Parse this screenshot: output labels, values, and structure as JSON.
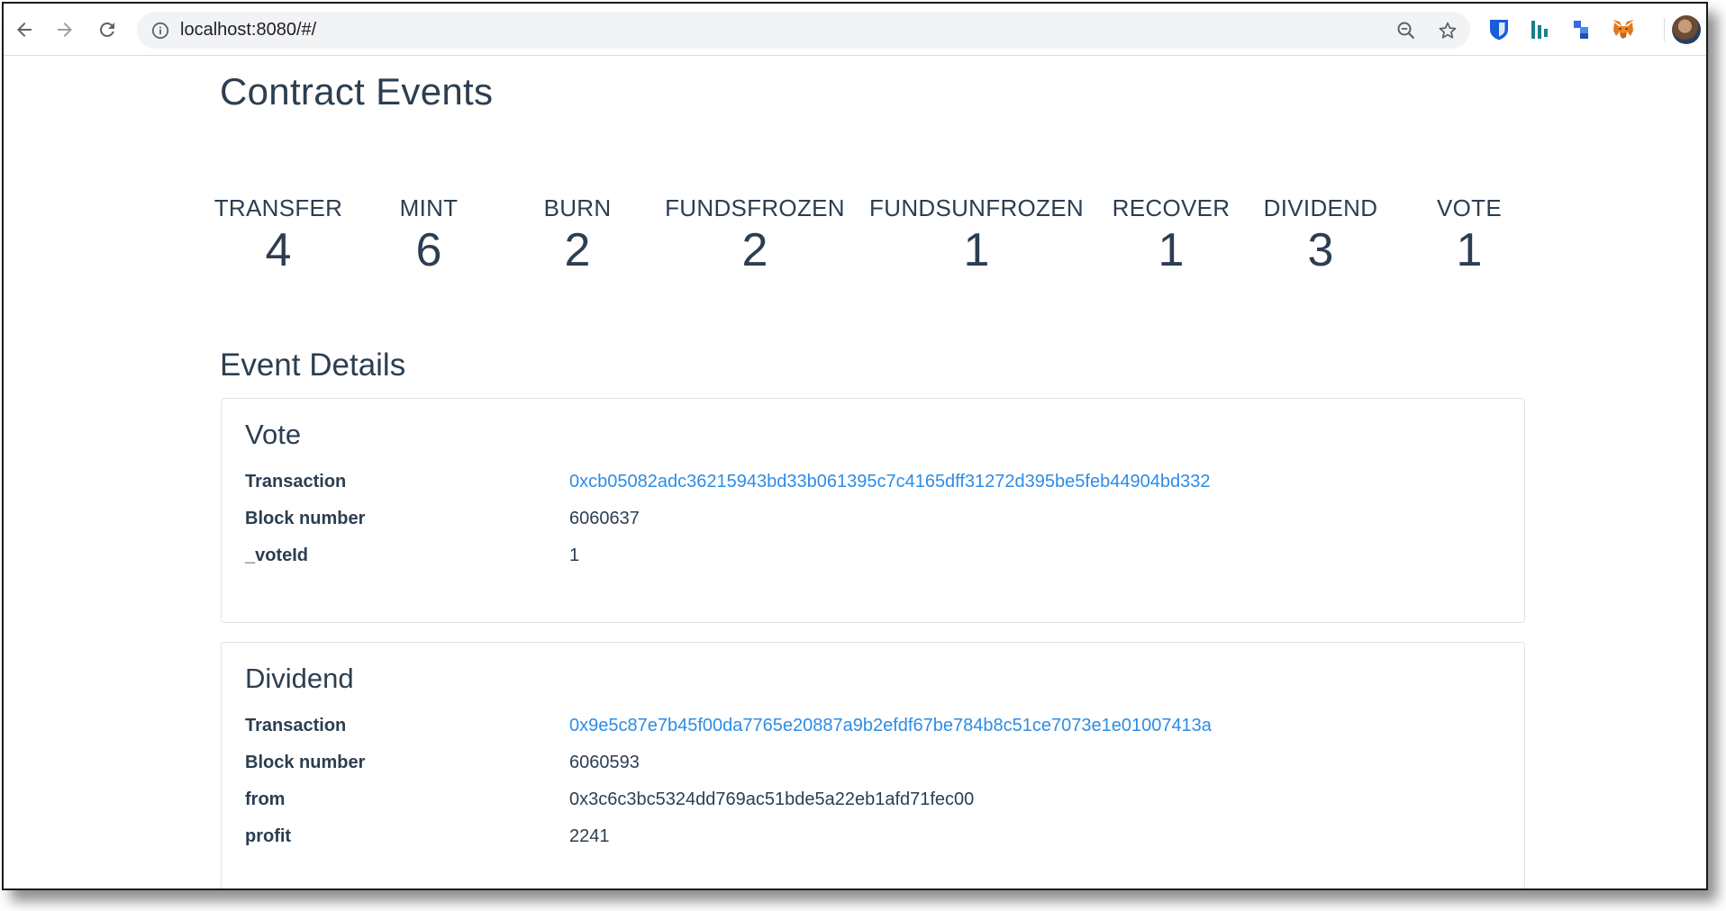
{
  "browser": {
    "url": "localhost:8080/#/",
    "icons": {
      "back": "arrow-left-icon",
      "forward": "arrow-right-icon",
      "reload": "reload-icon",
      "site_info": "info-circle-icon",
      "zoom": "zoom-out-icon",
      "bookmark": "star-icon",
      "extensions": [
        "bitwarden-icon",
        "chart-extension-icon",
        "blue-blocks-extension-icon",
        "metamask-fox-icon"
      ],
      "profile": "profile-avatar"
    }
  },
  "page": {
    "title": "Contract Events",
    "event_counts": [
      {
        "label": "TRANSFER",
        "count": "4"
      },
      {
        "label": "MINT",
        "count": "6"
      },
      {
        "label": "BURN",
        "count": "2"
      },
      {
        "label": "FUNDSFROZEN",
        "count": "2"
      },
      {
        "label": "FUNDSUNFROZEN",
        "count": "1"
      },
      {
        "label": "RECOVER",
        "count": "1"
      },
      {
        "label": "DIVIDEND",
        "count": "3"
      },
      {
        "label": "VOTE",
        "count": "1"
      }
    ],
    "details_title": "Event Details",
    "events": [
      {
        "name": "Vote",
        "fields": [
          {
            "key": "Transaction",
            "value": "0xcb05082adc36215943bd33b061395c7c4165dff31272d395be5feb44904bd332"
          },
          {
            "key": "Block number",
            "value": "6060637"
          },
          {
            "key": "_voteId",
            "value": "1"
          }
        ]
      },
      {
        "name": "Dividend",
        "fields": [
          {
            "key": "Transaction",
            "value": "0x9e5c87e7b45f00da7765e20887a9b2efdf67be784b8c51ce7073e1e01007413a"
          },
          {
            "key": "Block number",
            "value": "6060593"
          },
          {
            "key": "from",
            "value": "0x3c6c3bc5324dd769ac51bde5a22eb1afd71fec00"
          },
          {
            "key": "profit",
            "value": "2241"
          }
        ]
      }
    ]
  },
  "colors": {
    "text": "#2c3e50",
    "link": "#2d8ce6",
    "card_border": "#dfe3e8",
    "omnibox_bg": "#f1f3f4"
  }
}
